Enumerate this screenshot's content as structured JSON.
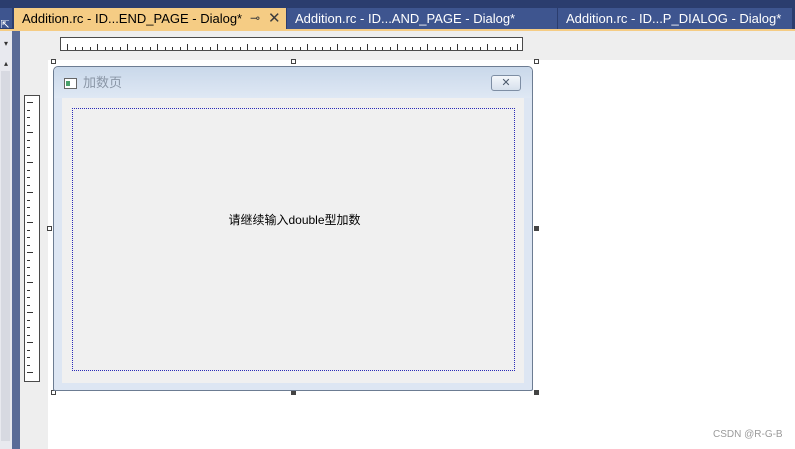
{
  "tabs": [
    {
      "label": "Addition.rc - ID...END_PAGE - Dialog*",
      "active": true
    },
    {
      "label": "Addition.rc - ID...AND_PAGE - Dialog*",
      "active": false
    },
    {
      "label": "Addition.rc - ID...P_DIALOG - Dialog*",
      "active": false
    }
  ],
  "tab_icons": {
    "pin": "⊸",
    "close": "✕"
  },
  "left_panel": {
    "stub_icon": "⇱",
    "dropdown_glyph": "▾",
    "scroll_up_glyph": "▴"
  },
  "dialog": {
    "title": "加数页",
    "close_glyph": "✕",
    "static_text": "请继续输入double型加数"
  },
  "watermark": "CSDN @R-G-B",
  "colors": {
    "tab_active": "#f5cc84",
    "tab_inactive": "#3e558f",
    "tabstrip_bg": "#2b3d6e",
    "guide_border": "#2b2bb8"
  }
}
